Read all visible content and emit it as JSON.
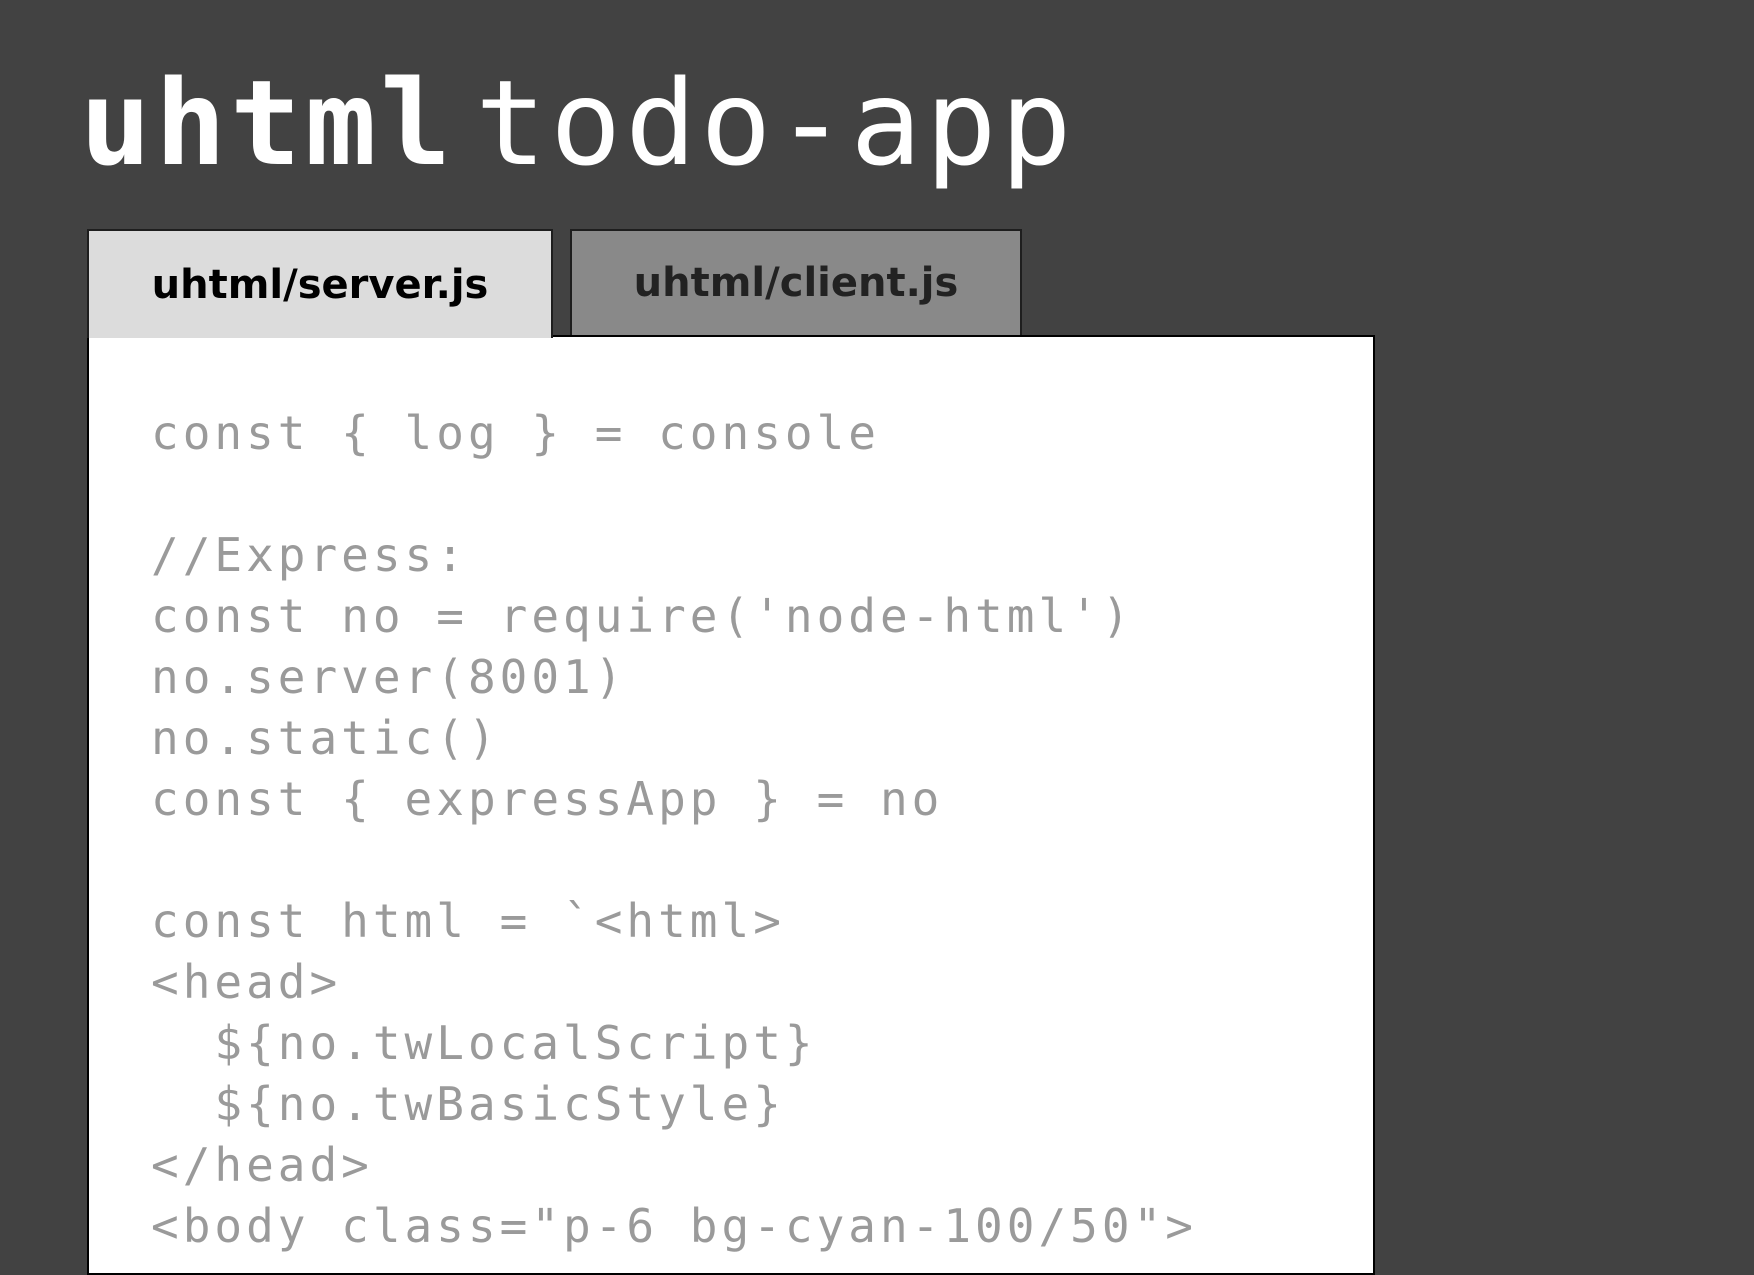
{
  "title": {
    "bold": "uhtml",
    "light": "todo-app"
  },
  "tabs": [
    {
      "label": "uhtml/server.js",
      "active": true
    },
    {
      "label": "uhtml/client.js",
      "active": false
    }
  ],
  "code": {
    "lines": [
      "const { log } = console",
      "",
      "//Express:",
      "const no = require('node-html')",
      "no.server(8001)",
      "no.static()",
      "const { expressApp } = no",
      "",
      "const html = `<html>",
      "<head>",
      "  ${no.twLocalScript}",
      "  ${no.twBasicStyle}",
      "</head>",
      "<body class=\"p-6 bg-cyan-100/50\">"
    ]
  },
  "colors": {
    "background": "#424242",
    "active_tab": "#dcdcdc",
    "inactive_tab": "#898989",
    "code_text": "#9a9a9a",
    "panel": "#ffffff"
  }
}
